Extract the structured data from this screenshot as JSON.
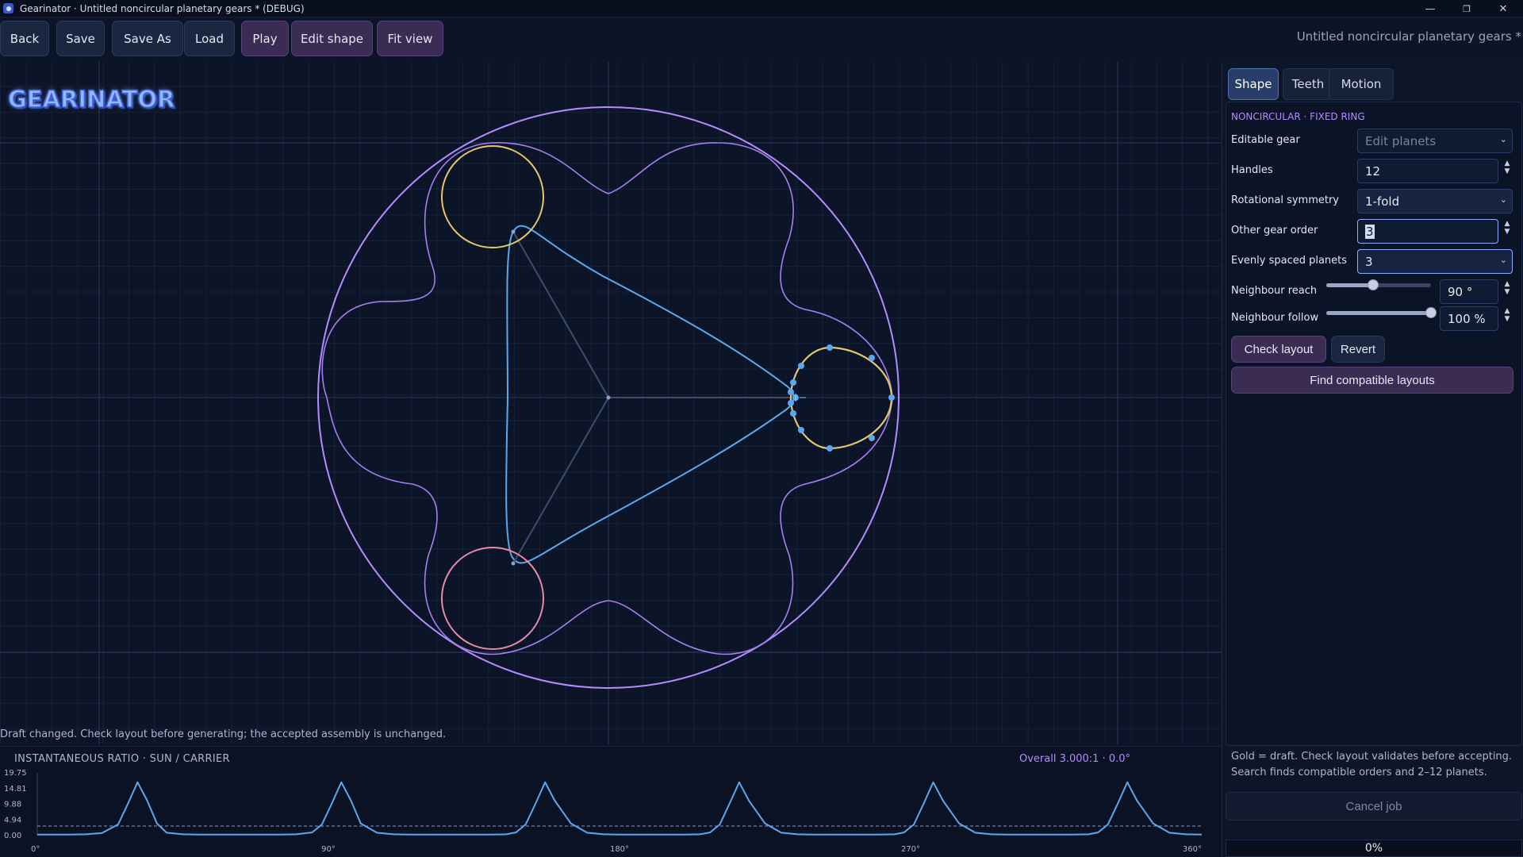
{
  "window": {
    "title": "Gearinator · Untitled noncircular planetary gears * (DEBUG)",
    "minimize": "—",
    "restore": "❐",
    "close": "✕"
  },
  "toolbar": {
    "back": "Back",
    "save": "Save",
    "save_as": "Save As",
    "load": "Load",
    "play": "Play",
    "edit_shape": "Edit shape",
    "fit_view": "Fit view",
    "document_title": "Untitled noncircular planetary gears *"
  },
  "logo": "GEARINATOR",
  "status_message": "Draft changed. Check layout before generating; the accepted assembly is unchanged.",
  "ratio_chart": {
    "title": "INSTANTANEOUS RATIO · SUN / CARRIER",
    "overall": "Overall 3.000:1  ·  0.0°"
  },
  "chart_data": {
    "type": "line",
    "title": "INSTANTANEOUS RATIO · SUN / CARRIER",
    "x_ticks": [
      "0°",
      "90°",
      "180°",
      "270°",
      "360°"
    ],
    "y_ticks": [
      "19.75",
      "14.81",
      "9.88",
      "4.94",
      "0.00"
    ],
    "xlim": [
      0,
      360
    ],
    "ylim": [
      0,
      19.75
    ],
    "reference_line": 3.0,
    "series": [
      {
        "x": [
          0,
          5,
          10,
          15,
          20,
          25,
          28,
          31,
          34,
          37,
          40,
          45,
          50,
          55,
          60,
          65,
          70,
          75,
          80,
          85,
          88,
          91,
          94,
          97,
          100,
          105,
          110,
          115,
          120,
          125,
          130,
          135,
          140,
          145,
          148,
          151,
          154,
          157,
          160,
          165,
          170,
          175,
          180,
          185,
          190,
          195,
          200,
          205,
          208,
          211,
          214,
          217,
          220,
          225,
          230,
          235,
          240,
          245,
          250,
          255,
          260,
          265,
          268,
          271,
          274,
          277,
          280,
          285,
          290,
          295,
          300,
          305,
          310,
          315,
          320,
          325,
          328,
          331,
          334,
          337,
          340,
          345,
          350,
          355,
          360
        ],
        "values": [
          0.3,
          0.3,
          0.3,
          0.4,
          0.8,
          3.5,
          10.0,
          16.8,
          11.0,
          3.8,
          0.9,
          0.4,
          0.3,
          0.3,
          0.3,
          0.3,
          0.3,
          0.3,
          0.4,
          1.0,
          3.5,
          10.0,
          16.8,
          11.0,
          3.8,
          0.9,
          0.4,
          0.3,
          0.3,
          0.3,
          0.3,
          0.3,
          0.3,
          0.4,
          1.0,
          3.5,
          10.0,
          16.8,
          11.0,
          3.8,
          0.9,
          0.4,
          0.3,
          0.3,
          0.3,
          0.3,
          0.3,
          0.4,
          1.0,
          3.5,
          10.0,
          16.8,
          11.0,
          3.8,
          0.9,
          0.4,
          0.3,
          0.3,
          0.3,
          0.3,
          0.3,
          0.4,
          1.0,
          3.5,
          10.0,
          16.8,
          11.0,
          3.8,
          0.9,
          0.4,
          0.3,
          0.3,
          0.3,
          0.3,
          0.3,
          0.4,
          1.0,
          3.5,
          10.0,
          16.8,
          11.0,
          3.8,
          0.9,
          0.4,
          0.3
        ]
      }
    ]
  },
  "panel": {
    "tabs": [
      "Shape",
      "Teeth",
      "Motion"
    ],
    "section_title": "NONCIRCULAR · FIXED RING",
    "rows": {
      "editable_gear": {
        "label": "Editable gear",
        "value": "Edit planets"
      },
      "handles": {
        "label": "Handles",
        "value": "12"
      },
      "rotational_symmetry": {
        "label": "Rotational symmetry",
        "value": "1-fold"
      },
      "other_gear_order": {
        "label": "Other gear order",
        "value": "3"
      },
      "evenly_spaced_planets": {
        "label": "Evenly spaced planets",
        "value": "3"
      },
      "neighbour_reach": {
        "label": "Neighbour reach",
        "value": "90 °",
        "fraction": 0.45
      },
      "neighbour_follow": {
        "label": "Neighbour follow",
        "value": "100 %",
        "fraction": 1.0
      }
    },
    "check_layout": "Check layout",
    "revert": "Revert",
    "find_compatible": "Find compatible layouts",
    "hint": "Gold = draft. Check layout validates before accepting. Search finds compatible orders and 2–12 planets.",
    "cancel_job": "Cancel job",
    "progress": "0%"
  },
  "colors": {
    "background": "#0c1427",
    "ring": "#b48cff",
    "sun": "#5aa9f0",
    "draft_planet": "#e8c66a",
    "pink_planet": "#e88aa8",
    "accent_purple": "#3a2c52",
    "active_tab": "#283d6a"
  }
}
